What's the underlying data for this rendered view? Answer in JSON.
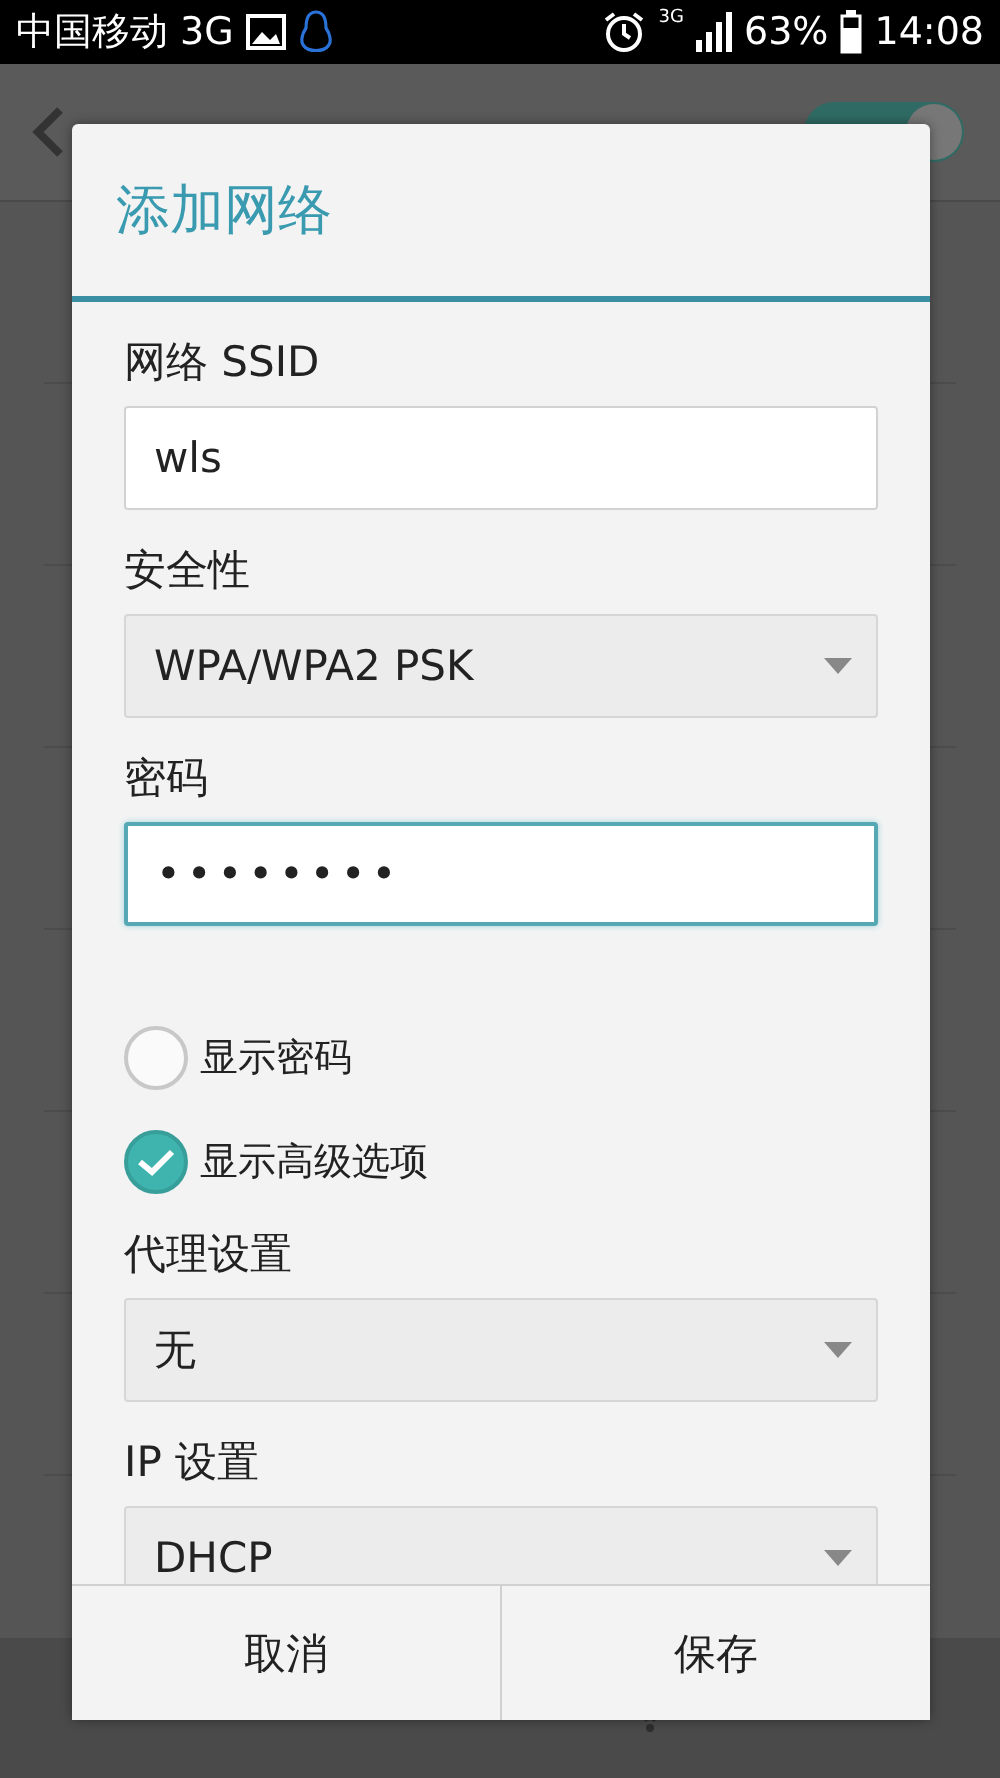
{
  "status_bar": {
    "carrier": "中国移动 3G",
    "network": "3G",
    "battery": "63%",
    "time": "14:08"
  },
  "background": {
    "wlan_switch": {
      "on": true
    }
  },
  "dialog": {
    "title": "添加网络",
    "fields": [
      {
        "kind": "text",
        "label": "网络 SSID",
        "value": "wls",
        "focused": false
      },
      {
        "kind": "select",
        "label": "安全性",
        "value": "WPA/WPA2 PSK"
      },
      {
        "kind": "password",
        "label": "密码",
        "value": "••••••••",
        "focused": true
      }
    ],
    "checkboxes": [
      {
        "label": "显示密码",
        "checked": false
      },
      {
        "label": "显示高级选项",
        "checked": true
      }
    ],
    "advanced": [
      {
        "kind": "select",
        "label": "代理设置",
        "value": "无"
      },
      {
        "kind": "select",
        "label": "IP 设置",
        "value": "DHCP"
      }
    ],
    "buttons": [
      "取消",
      "保存"
    ]
  }
}
